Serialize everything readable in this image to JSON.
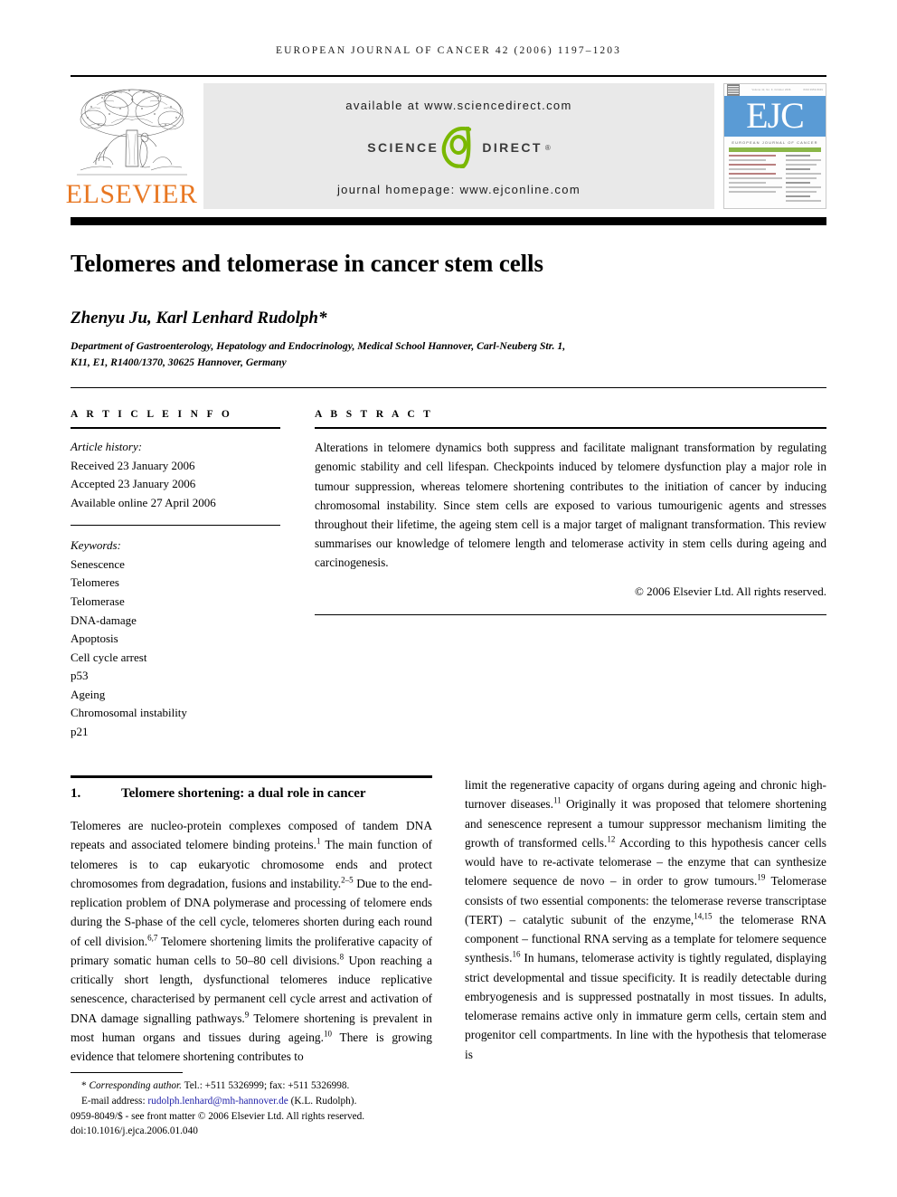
{
  "running_head": "EUROPEAN JOURNAL OF CANCER 42 (2006) 1197–1203",
  "masthead": {
    "publisher_name": "ELSEVIER",
    "publisher_logo_icon": "elsevier-tree-icon",
    "available_at": "available at www.sciencedirect.com",
    "sciencedirect_left": "SCIENCE",
    "sciencedirect_right": "DIRECT",
    "sciencedirect_mark": "d",
    "registered_mark": "®",
    "journal_homepage": "journal homepage: www.ejconline.com",
    "cover": {
      "logo_text": "EJC",
      "tagline": "EUROPEAN JOURNAL OF CANCER",
      "header_left": "Volume 42, No. 9, October 2006",
      "header_right": "ISSN 0959-8049"
    },
    "colors": {
      "elsevier_orange": "#e87722",
      "sciencedirect_green": "#7ab800",
      "cover_blue": "#5a9bd5",
      "cover_green": "#8ab648",
      "banner_grey": "#e9e9e9"
    }
  },
  "article": {
    "title": "Telomeres and telomerase in cancer stem cells",
    "authors": "Zhenyu Ju, Karl Lenhard Rudolph*",
    "affiliation_line1": "Department of Gastroenterology, Hepatology and Endocrinology, Medical School Hannover, Carl-Neuberg Str. 1,",
    "affiliation_line2": "K11, E1, R1400/1370, 30625 Hannover, Germany"
  },
  "article_info": {
    "heading": "A R T I C L E   I N F O",
    "history_label": "Article history:",
    "history": [
      "Received 23 January 2006",
      "Accepted 23 January 2006",
      "Available online 27 April 2006"
    ],
    "keywords_label": "Keywords:",
    "keywords": [
      "Senescence",
      "Telomeres",
      "Telomerase",
      "DNA-damage",
      "Apoptosis",
      "Cell cycle arrest",
      "p53",
      "Ageing",
      "Chromosomal instability",
      "p21"
    ]
  },
  "abstract": {
    "heading": "A B S T R A C T",
    "text": "Alterations in telomere dynamics both suppress and facilitate malignant transformation by regulating genomic stability and cell lifespan. Checkpoints induced by telomere dysfunction play a major role in tumour suppression, whereas telomere shortening contributes to the initiation of cancer by inducing chromosomal instability. Since stem cells are exposed to various tumourigenic agents and stresses throughout their lifetime, the ageing stem cell is a major target of malignant transformation. This review summarises our knowledge of telomere length and telomerase activity in stem cells during ageing and carcinogenesis.",
    "copyright": "© 2006 Elsevier Ltd. All rights reserved."
  },
  "body": {
    "section_number": "1.",
    "section_title": "Telomere shortening: a dual role in cancer",
    "left_column_html": "Telomeres are nucleo-protein complexes composed of tandem DNA repeats and associated telomere binding proteins.<sup>1</sup> The main function of telomeres is to cap eukaryotic chromosome ends and protect chromosomes from degradation, fusions and instability.<sup>2–5</sup> Due to the end-replication problem of DNA polymerase and processing of telomere ends during the S-phase of the cell cycle, telomeres shorten during each round of cell division.<sup>6,7</sup> Telomere shortening limits the proliferative capacity of primary somatic human cells to 50–80 cell divisions.<sup>8</sup> Upon reaching a critically short length, dysfunctional telomeres induce replicative senescence, characterised by permanent cell cycle arrest and activation of DNA damage signalling pathways.<sup>9</sup> Telomere shortening is prevalent in most human organs and tissues during ageing.<sup>10</sup> There is growing evidence that telomere shortening contributes to",
    "right_column_html": "limit the regenerative capacity of organs during ageing and chronic high-turnover diseases.<sup>11</sup> Originally it was proposed that telomere shortening and senescence represent a tumour suppressor mechanism limiting the growth of transformed cells.<sup>12</sup> According to this hypothesis cancer cells would have to re-activate telomerase – the enzyme that can synthesize telomere sequence de novo – in order to grow tumours.<sup>19</sup> Telomerase consists of two essential components: the telomerase reverse transcriptase (TERT) – catalytic subunit of the enzyme,<sup>14,15</sup> the telomerase RNA component – functional RNA serving as a template for telomere sequence synthesis.<sup>16</sup> In humans, telomerase activity is tightly regulated, displaying strict developmental and tissue specificity. It is readily detectable during embryogenesis and is suppressed postnatally in most tissues. In adults, telomerase remains active only in immature germ cells, certain stem and progenitor cell compartments. In line with the hypothesis that telomerase is"
  },
  "footnote": {
    "corresponding_marker": "*",
    "corresponding_label": "Corresponding author.",
    "corresponding_contact": " Tel.: +511 5326999; fax: +511 5326998.",
    "email_label": "E-mail address:",
    "email_address": "rudolph.lenhard@mh-hannover.de",
    "email_attribution": "(K.L. Rudolph).",
    "issn_line": "0959-8049/$ - see front matter © 2006 Elsevier Ltd. All rights reserved.",
    "doi_line": "doi:10.1016/j.ejca.2006.01.040"
  }
}
